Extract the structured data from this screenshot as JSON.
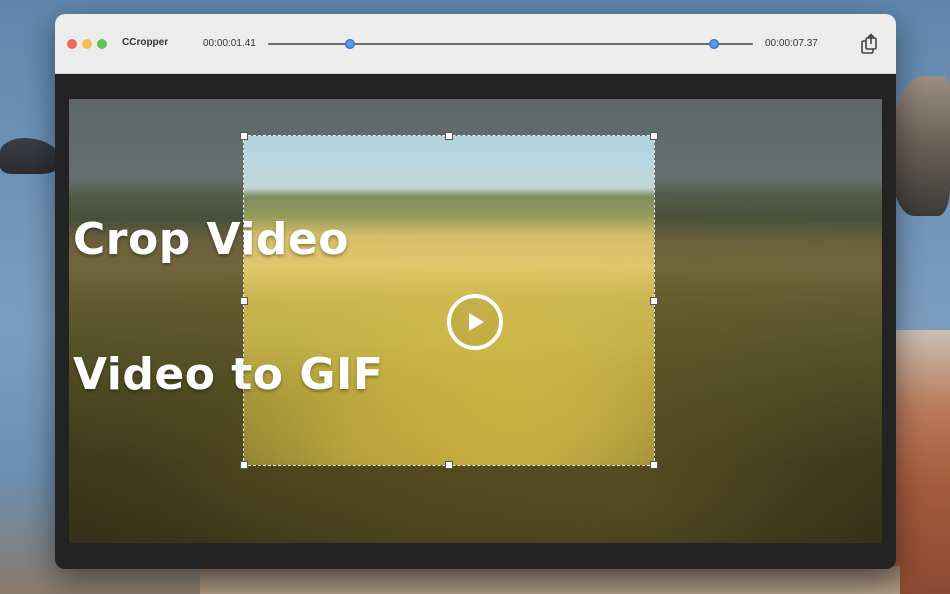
{
  "window": {
    "app_title": "CCropper",
    "time_start": "00:00:01.41",
    "time_end": "00:00:07.37",
    "trim_start_fraction": 0.17,
    "trim_end_fraction": 0.92
  },
  "overlay": {
    "line1": "Crop Video",
    "line2": "Video to GIF"
  },
  "icons": {
    "share": "share-icon",
    "play": "play-icon"
  },
  "colors": {
    "accent": "#3b7fe0",
    "close": "#ed6a5e",
    "minimize": "#f5bf4f",
    "maximize": "#61c554"
  }
}
